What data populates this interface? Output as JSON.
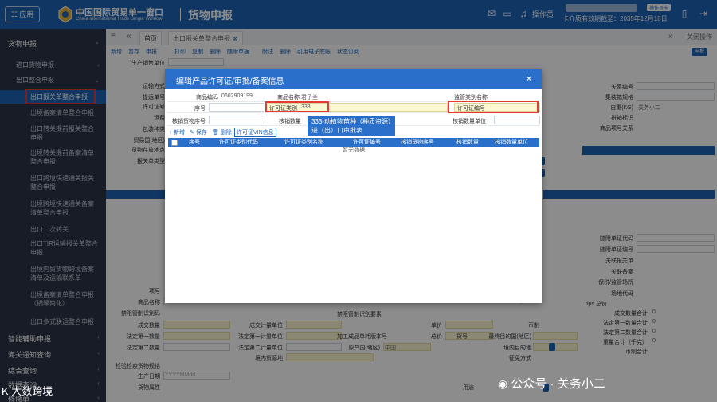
{
  "topbar": {
    "menu_label": "应用",
    "logo_cn": "中国国际贸易单一窗口",
    "logo_en": "China International Trade Single Window",
    "page_title": "货物申报",
    "user_label": "操作员",
    "badge": "操作员卡",
    "cert_text": "卡介质有效期截至：2035年12月18日"
  },
  "tabs": {
    "home": "首页",
    "active": "出口报关单整合申报",
    "close_ops": "关闭操作"
  },
  "sidebar": {
    "section": "货物申报",
    "items": [
      {
        "label": "进口货物申报"
      },
      {
        "label": "出口整合申报"
      }
    ],
    "subitems": [
      "出口报关单整合申报",
      "出境备案清单整合申报",
      "出口转关提前报关整合申报",
      "出境转关提前备案清单整合申报",
      "出口跨境快速通关报关整合申报",
      "出境跨境快速通关备案清单整合申报",
      "出口二次转关",
      "出口TIR运输报关单整合申报",
      "出境内贸货物跨境备案清单及运输联系单",
      "出境备案清单整合申报（横琴简化）",
      "出口多式联运整合申报"
    ],
    "bottom": [
      "智能辅助申报",
      "海关通知查询",
      "综合查询",
      "数据查询",
      "修撤单"
    ]
  },
  "background": {
    "toolbar": [
      "新增",
      "暂存",
      "申报",
      "打印",
      "复制",
      "删除",
      "随附单据",
      "附注",
      "删除",
      "引用电子底账",
      "状态订阅"
    ],
    "right_toolbar": "申报",
    "right_labels": [
      "关系编号",
      "集装箱规格",
      "自重(KG)",
      "拼箱标识",
      "商品项号关系"
    ],
    "right_value": "关务小二",
    "left_labels": [
      "生产销售单位",
      "运输方式",
      "提运单号",
      "许可证号",
      "运费",
      "包装种类",
      "贸易国(地区)",
      "货物存放地点",
      "报关单类型"
    ],
    "bottom_labels": [
      "项号",
      "商品名称",
      "禁限管制识别码",
      "成交数量",
      "法定第一数量",
      "法定第二数量",
      "检验检疫货物规格",
      "生产日期",
      "货物属性"
    ],
    "bottom_mid_labels": [
      "成交计量单位",
      "法定第一计量单位",
      "法定第二计量单位",
      "境内货源地",
      "用途"
    ],
    "bottom_right_labels": [
      "单价",
      "总价",
      "币制",
      "境内目的地",
      "最终目的国(地区)",
      "征免方式",
      "原产国(地区)",
      "货号",
      "加工成品单耗版本号",
      "禁限管制识别要素"
    ],
    "right_bottom_labels": [
      "随附单证代码",
      "随附单证编号",
      "关联报关单",
      "关联备案",
      "保税/监管场所",
      "场地代码"
    ],
    "totals_label": "tips 总价",
    "totals": [
      "成交数量合计",
      "法定第一数量合计",
      "法定第二数量合计",
      "重量合计（千克）",
      "币制合计"
    ],
    "totals_value": "0",
    "fill_value": "中国",
    "date_placeholder": "YYYYMMdd"
  },
  "modal": {
    "title": "编辑产品许可证/审批/备案信息",
    "close": "×",
    "row1": {
      "code_label": "商品编码",
      "code_value": "0602909199",
      "name_label": "商品名称",
      "name_value": "君子兰",
      "sup_label": "监管类别名称"
    },
    "row2": {
      "seq_label": "序号",
      "lic_type_label": "许可证类别",
      "lic_type_value": "333",
      "lic_no_label": "许可证编号"
    },
    "row3": {
      "seq_label": "核销货物序号",
      "qty_label": "核销数量",
      "unit_label": "核销数量单位"
    },
    "tooltip": "333-动植物苗种（种质资源）进（出）口审批表",
    "toolbar": {
      "add": "新增",
      "save": "保存",
      "delete": "删除",
      "vin": "许可证VIN信息"
    },
    "columns": [
      "序号",
      "许可证类别代码",
      "许可证类别名称",
      "许可证编号",
      "核销货物序号",
      "核销数量",
      "核销数量单位"
    ],
    "empty": "暂无数据"
  },
  "watermark": {
    "right": "公众号 · 关务小二",
    "left": "大数跨境"
  }
}
